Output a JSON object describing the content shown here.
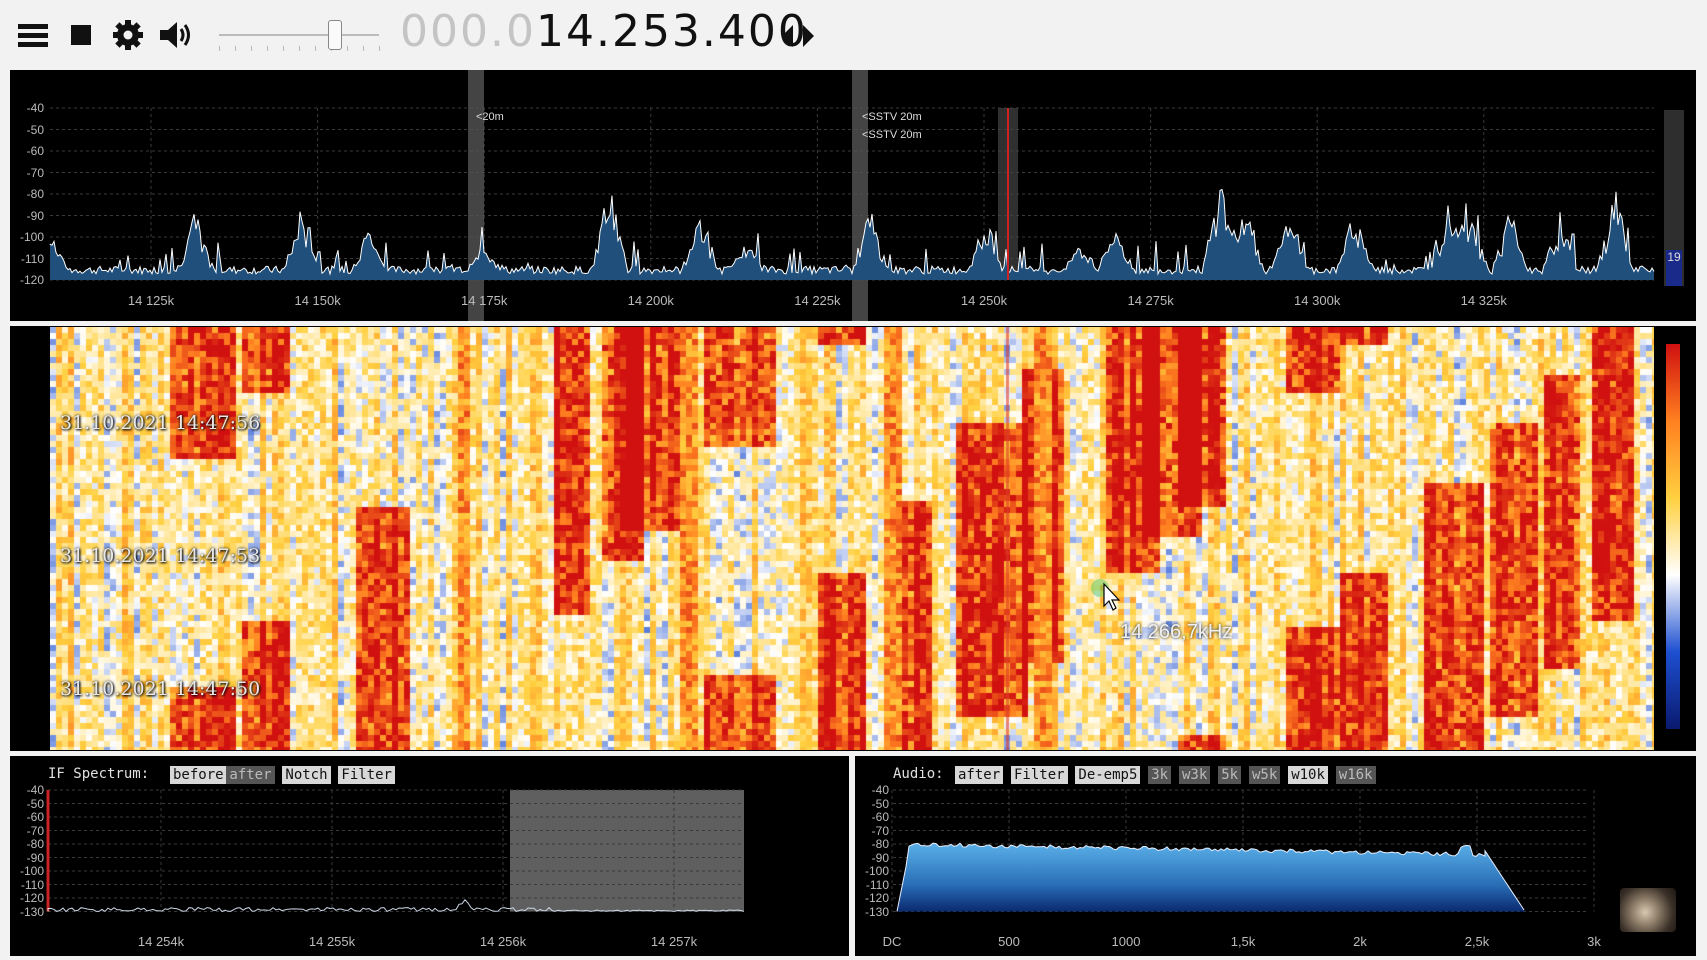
{
  "toolbar": {
    "menu_icon": "menu-icon",
    "stop_icon": "stop-icon",
    "settings_icon": "gear-icon",
    "volume_icon": "speaker-icon",
    "volume_level": 0.72,
    "frequency_prefix": "000.0",
    "frequency_main": "14.253.400",
    "tune_arrows_icon": "left-right-arrows-icon"
  },
  "spectrum": {
    "y_ticks": [
      "-40",
      "-50",
      "-60",
      "-70",
      "-80",
      "-90",
      "-100",
      "-110",
      "-120"
    ],
    "x_ticks": [
      "14 125k",
      "14 150k",
      "14 175k",
      "14 200k",
      "14 225k",
      "14 250k",
      "14 275k",
      "14 300k",
      "14 325k"
    ],
    "markers": [
      {
        "label": "<20m"
      },
      {
        "label": "<SSTV 20m"
      },
      {
        "label": "<SSTV 20m"
      }
    ],
    "level_value": "19",
    "colors": {
      "fill": "#1f4f7a",
      "line": "#ffffff",
      "tuned_marker": "#cc2222",
      "band_marker": "#555555"
    }
  },
  "waterfall": {
    "timestamps": [
      "31.10.2021 14:47:56",
      "31.10.2021 14:47:53",
      "31.10.2021 14:47:50"
    ],
    "cursor_frequency": "14 266,7kHz",
    "colormap": [
      "#0a1a6e",
      "#1d4fd0",
      "#ffffff",
      "#ffd040",
      "#ff8020",
      "#d01010"
    ]
  },
  "if_spectrum": {
    "title": "IF Spectrum:",
    "buttons": [
      {
        "label": "before",
        "active": true
      },
      {
        "label": "after",
        "active": false
      },
      {
        "label": "Notch",
        "active": true
      },
      {
        "label": "Filter",
        "active": true
      }
    ],
    "y_ticks": [
      "-40",
      "-50",
      "-60",
      "-70",
      "-80",
      "-90",
      "-100",
      "-110",
      "-120",
      "-130"
    ],
    "x_ticks": [
      "14 254k",
      "14 255k",
      "14 256k",
      "14 257k"
    ]
  },
  "audio": {
    "title": "Audio:",
    "buttons": [
      {
        "label": "after",
        "active": true
      },
      {
        "label": "Filter",
        "active": true
      },
      {
        "label": "De-emp5",
        "active": true
      },
      {
        "label": "3k",
        "active": false
      },
      {
        "label": "w3k",
        "active": false
      },
      {
        "label": "5k",
        "active": false
      },
      {
        "label": "w5k",
        "active": false
      },
      {
        "label": "w10k",
        "active": true
      },
      {
        "label": "w16k",
        "active": false
      }
    ],
    "y_ticks": [
      "-40",
      "-50",
      "-60",
      "-70",
      "-80",
      "-90",
      "-100",
      "-110",
      "-120",
      "-130"
    ],
    "x_ticks": [
      "DC",
      "500",
      "1000",
      "1,5k",
      "2k",
      "2,5k",
      "3k"
    ],
    "thumbnail": "cat-thumbnail"
  }
}
